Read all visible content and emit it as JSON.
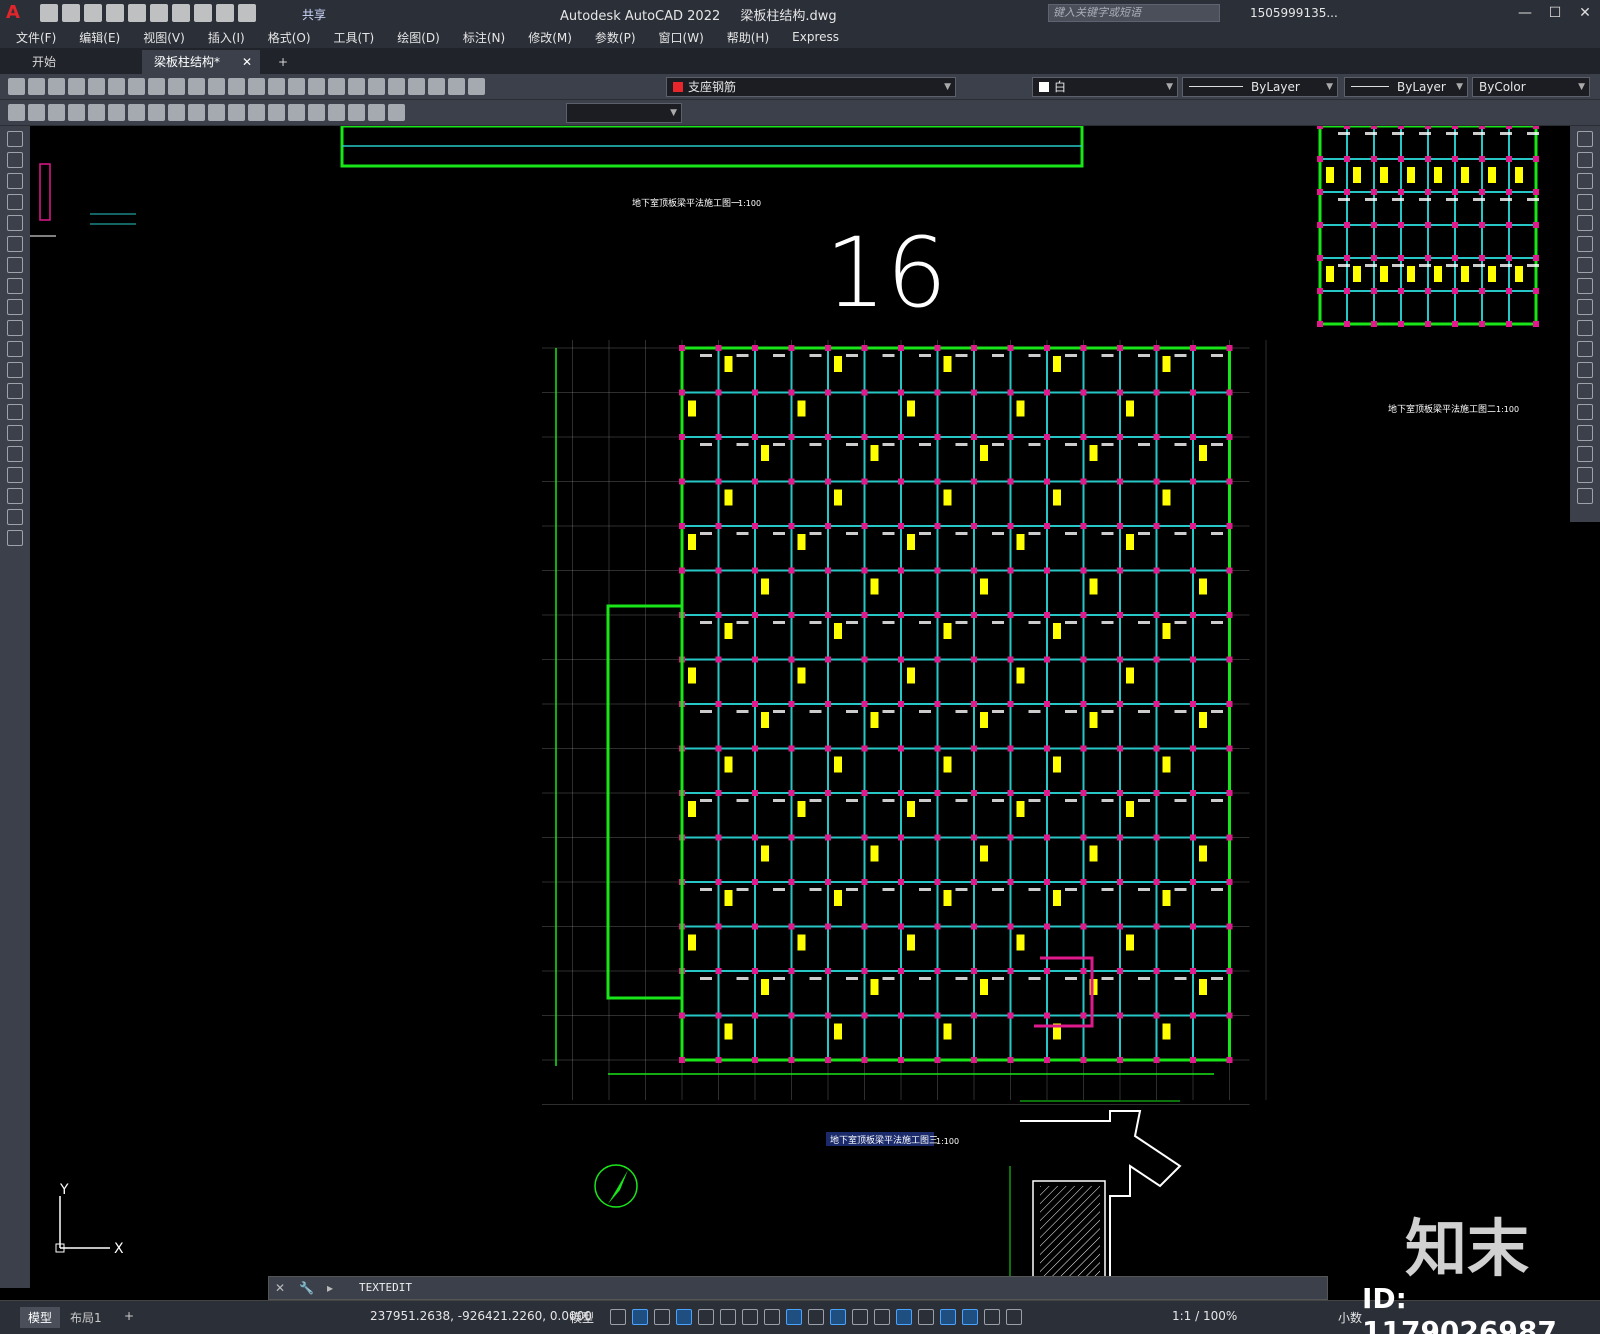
{
  "app": {
    "logo": "A",
    "title": "Autodesk AutoCAD 2022",
    "document": "梁板柱结构.dwg",
    "share_label": "共享",
    "search_placeholder": "键入关键字或短语",
    "user": "1505999135...",
    "window_controls": [
      "—",
      "☐",
      "✕"
    ]
  },
  "menu": [
    "文件(F)",
    "编辑(E)",
    "视图(V)",
    "插入(I)",
    "格式(O)",
    "工具(T)",
    "绘图(D)",
    "标注(N)",
    "修改(M)",
    "参数(P)",
    "窗口(W)",
    "帮助(H)",
    "Express"
  ],
  "tabs": [
    {
      "label": "开始",
      "active": false
    },
    {
      "label": "梁板柱结构*",
      "active": true
    }
  ],
  "tab_add": "+",
  "properties": {
    "layer": "支座钢筋",
    "layer_color": "#e8262b",
    "color": "白",
    "linetype": "ByLayer",
    "lineweight": "ByLayer",
    "plotstyle": "ByColor"
  },
  "drawing": {
    "number_sketch": "16",
    "plan_title_1": "地下室顶板梁平法施工图一",
    "plan_scale_1": "1:100",
    "plan_title_2": "地下室顶板梁平法施工图二",
    "plan_scale_2": "1:100",
    "plan_title_3": "地下室顶板梁平法施工图三",
    "plan_scale_3": "1:100",
    "ucs_x": "X",
    "ucs_y": "Y"
  },
  "command": {
    "text": "TEXTEDIT"
  },
  "status": {
    "layout_tabs": [
      "模型",
      "布局1"
    ],
    "add_layout": "+",
    "coords": "237951.2638, -926421.2260, 0.0000",
    "space": "模型",
    "scale": "1:1 / 100%",
    "units": "小数"
  },
  "watermark": {
    "logo": "知末",
    "id": "ID: 1179026987"
  },
  "colors": {
    "beam": "#19e619",
    "column": "#e0198c",
    "grid": "#9a9a9a",
    "annotation": "#ffff00",
    "cyan": "#27c7c7"
  }
}
